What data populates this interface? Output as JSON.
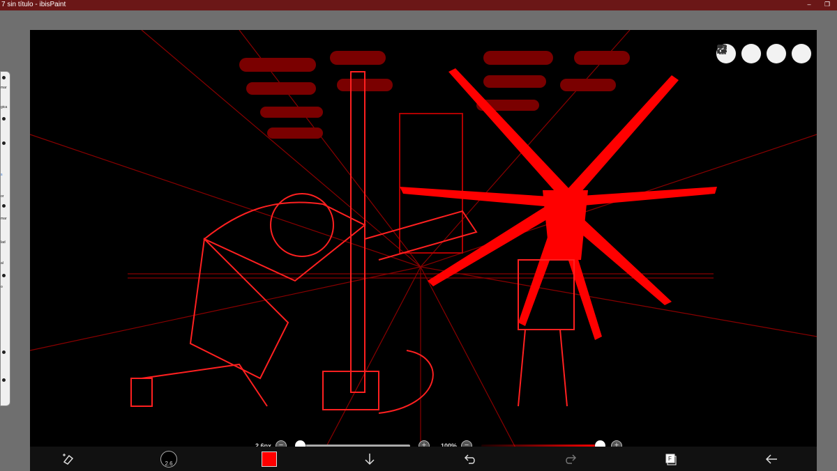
{
  "window": {
    "title": "7 sin título - ibisPaint",
    "minimize": "–",
    "restore": "❐"
  },
  "left_panel": {
    "labels": [
      "mar",
      "gica",
      "s",
      "or",
      "mar",
      "lad",
      "al",
      "o"
    ]
  },
  "brush": {
    "size_label": "2.6px",
    "size_value_badge": "2.6",
    "size_fraction": 0.0,
    "opacity_label": "100%",
    "opacity_fraction": 1.0
  },
  "buttons": {
    "minus": "−",
    "plus": "+"
  },
  "colors": {
    "accent": "#ff0000",
    "titlebar": "#6b1717",
    "canvas": "#000000"
  },
  "bottom_toolbar": {
    "items": [
      "eraser-transform-icon",
      "brush-size-icon",
      "color-swatch",
      "download-icon",
      "undo-icon",
      "redo-icon",
      "layers-icon",
      "back-icon"
    ],
    "layer_badge": "F"
  },
  "top_tools": [
    "toggle-icon",
    "selection-icon",
    "hand-icon",
    "pen-icon"
  ]
}
